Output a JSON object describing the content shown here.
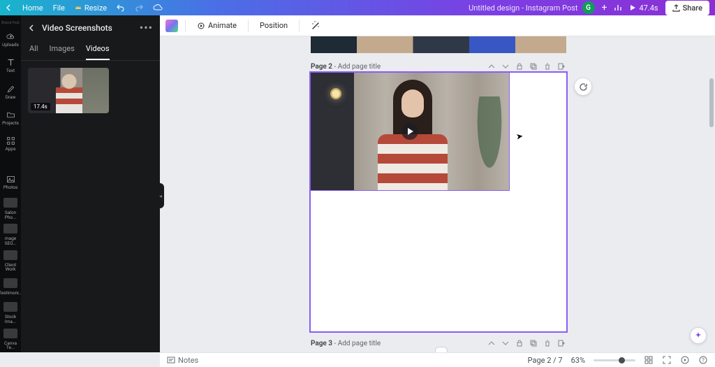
{
  "header": {
    "home": "Home",
    "file": "File",
    "resize": "Resize",
    "title": "Untitled design - Instagram Post",
    "avatar_initial": "G",
    "duration": "47.4s",
    "share": "Share"
  },
  "toolbar": {
    "animate": "Animate",
    "position": "Position"
  },
  "rail": {
    "top_label": "Brand Hub",
    "items": [
      "Uploads",
      "Text",
      "Draw",
      "Projects",
      "Apps",
      "",
      "Photos"
    ],
    "folders": [
      "Salon Pho...",
      "mage SEO...",
      "Client Work",
      "Testimoni...",
      "Stock Ima...",
      "Canva Te..."
    ]
  },
  "panel": {
    "title": "Video Screenshots",
    "tabs": {
      "all": "All",
      "images": "Images",
      "videos": "Videos"
    },
    "thumb_duration": "17.4s"
  },
  "pages": {
    "p2_label_strong": "Page 2",
    "p2_label_rest": " - Add page title",
    "p3_label_strong": "Page 3",
    "p3_label_rest": " - Add page title"
  },
  "footer": {
    "notes": "Notes",
    "page_indicator": "Page 2 / 7",
    "zoom": "63%"
  }
}
